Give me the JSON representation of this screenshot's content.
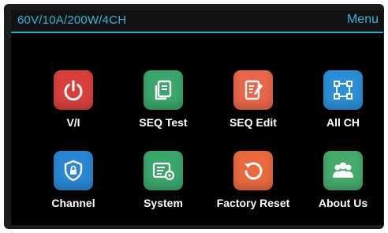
{
  "header": {
    "title": "60V/10A/200W/4CH",
    "menu_label": "Menu"
  },
  "colors": {
    "accent": "#35b4d6",
    "background": "#000000"
  },
  "tiles": [
    {
      "label": "V/I",
      "icon": "power-icon",
      "color": "#d8403c"
    },
    {
      "label": "SEQ Test",
      "icon": "document-icon",
      "color": "#3aa66b"
    },
    {
      "label": "SEQ Edit",
      "icon": "edit-document-icon",
      "color": "#e8674a"
    },
    {
      "label": "All CH",
      "icon": "channels-grid-icon",
      "color": "#2a8fd6"
    },
    {
      "label": "Channel",
      "icon": "shield-lock-icon",
      "color": "#2a86d2"
    },
    {
      "label": "System",
      "icon": "system-settings-icon",
      "color": "#3aa66b"
    },
    {
      "label": "Factory Reset",
      "icon": "reset-icon",
      "color": "#e86a3e"
    },
    {
      "label": "About Us",
      "icon": "users-icon",
      "color": "#45aa6b"
    }
  ]
}
